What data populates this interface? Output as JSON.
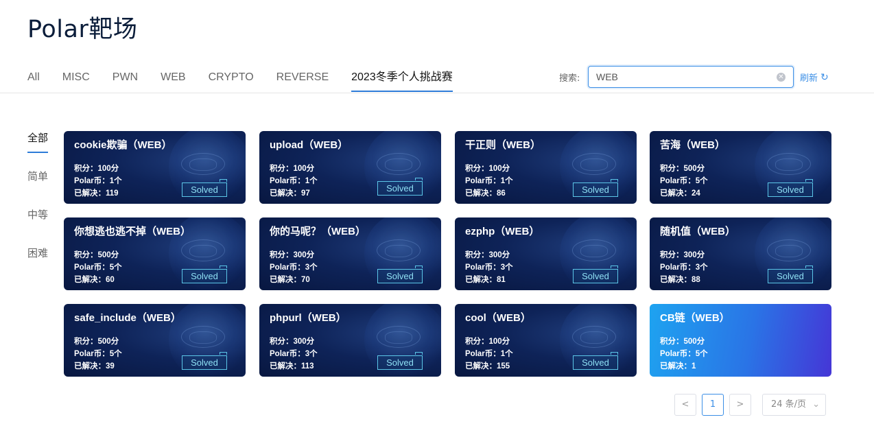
{
  "title": "Polar靶场",
  "tabs": [
    {
      "label": "All"
    },
    {
      "label": "MISC"
    },
    {
      "label": "PWN"
    },
    {
      "label": "WEB"
    },
    {
      "label": "CRYPTO"
    },
    {
      "label": "REVERSE"
    },
    {
      "label": "2023冬季个人挑战赛",
      "active": true
    }
  ],
  "search": {
    "label": "搜索:",
    "value": "WEB",
    "refresh_label": "刷新"
  },
  "sidebar": {
    "items": [
      {
        "label": "全部",
        "active": true
      },
      {
        "label": "简单"
      },
      {
        "label": "中等"
      },
      {
        "label": "困难"
      }
    ]
  },
  "cards": [
    {
      "title": "cookie欺骗（WEB）",
      "score": "积分：100分",
      "coin": "Polar币：1个",
      "solved_count": "已解决：119",
      "status": "Solved"
    },
    {
      "title": "upload（WEB）",
      "score": "积分：100分",
      "coin": "Polar币：1个",
      "solved_count": "已解决：97",
      "status": "Solved"
    },
    {
      "title": "干正则（WEB）",
      "score": "积分：100分",
      "coin": "Polar币：1个",
      "solved_count": "已解决：86",
      "status": "Solved"
    },
    {
      "title": "苦海（WEB）",
      "score": "积分：500分",
      "coin": "Polar币：5个",
      "solved_count": "已解决：24",
      "status": "Solved"
    },
    {
      "title": "你想逃也逃不掉（WEB）",
      "score": "积分：500分",
      "coin": "Polar币：5个",
      "solved_count": "已解决：60",
      "status": "Solved"
    },
    {
      "title": "你的马呢？（WEB）",
      "score": "积分：300分",
      "coin": "Polar币：3个",
      "solved_count": "已解决：70",
      "status": "Solved"
    },
    {
      "title": "ezphp（WEB）",
      "score": "积分：300分",
      "coin": "Polar币：3个",
      "solved_count": "已解决：81",
      "status": "Solved"
    },
    {
      "title": "随机值（WEB）",
      "score": "积分：300分",
      "coin": "Polar币：3个",
      "solved_count": "已解决：88",
      "status": "Solved"
    },
    {
      "title": "safe_include（WEB）",
      "score": "积分：500分",
      "coin": "Polar币：5个",
      "solved_count": "已解决：39",
      "status": "Solved"
    },
    {
      "title": "phpurl（WEB）",
      "score": "积分：300分",
      "coin": "Polar币：3个",
      "solved_count": "已解决：113",
      "status": "Solved"
    },
    {
      "title": "cool（WEB）",
      "score": "积分：100分",
      "coin": "Polar币：1个",
      "solved_count": "已解决：155",
      "status": "Solved"
    },
    {
      "title": "CB链（WEB）",
      "score": "积分：500分",
      "coin": "Polar币：5个",
      "solved_count": "已解决：1",
      "status": ""
    }
  ],
  "pagination": {
    "prev": "<",
    "current": "1",
    "next": ">",
    "page_size": "24 条/页"
  },
  "colors": {
    "accent": "#3a8ee6",
    "card_dark": "#0e2358",
    "card_gradient_start": "#1ea3f0",
    "card_gradient_end": "#4536d6",
    "solved_border": "#5cc7e8"
  }
}
